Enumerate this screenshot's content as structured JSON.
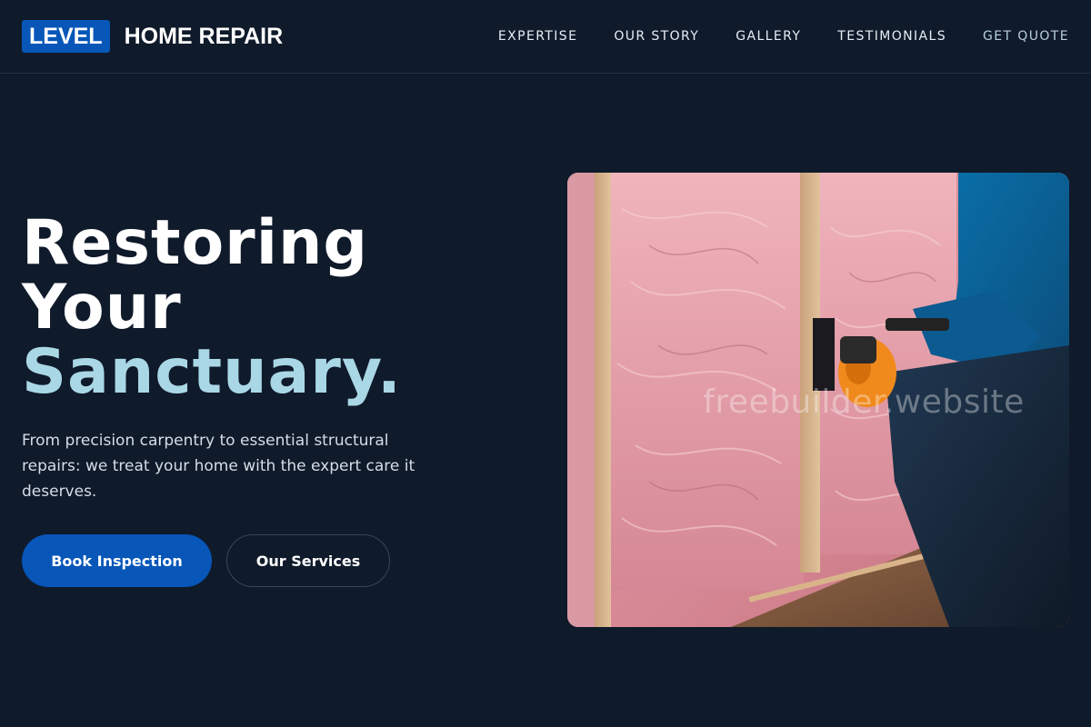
{
  "header": {
    "logo_badge": "LEVEL",
    "logo_text": "HOME REPAIR",
    "nav": [
      {
        "label": "EXPERTISE"
      },
      {
        "label": "OUR STORY"
      },
      {
        "label": "GALLERY"
      },
      {
        "label": "TESTIMONIALS"
      },
      {
        "label": "GET QUOTE"
      }
    ]
  },
  "hero": {
    "headline_line1": "Restoring",
    "headline_line2": "Your",
    "headline_accent": "Sanctuary.",
    "lede": "From precision carpentry to essential structural repairs: we treat your home with the expert care it deserves.",
    "primary_button": "Book Inspection",
    "secondary_button": "Our Services",
    "image_watermark": "freebuilder.website"
  },
  "colors": {
    "background": "#0f1a2a",
    "accent_blue": "#0756b8",
    "accent_light": "#aad7e6"
  }
}
